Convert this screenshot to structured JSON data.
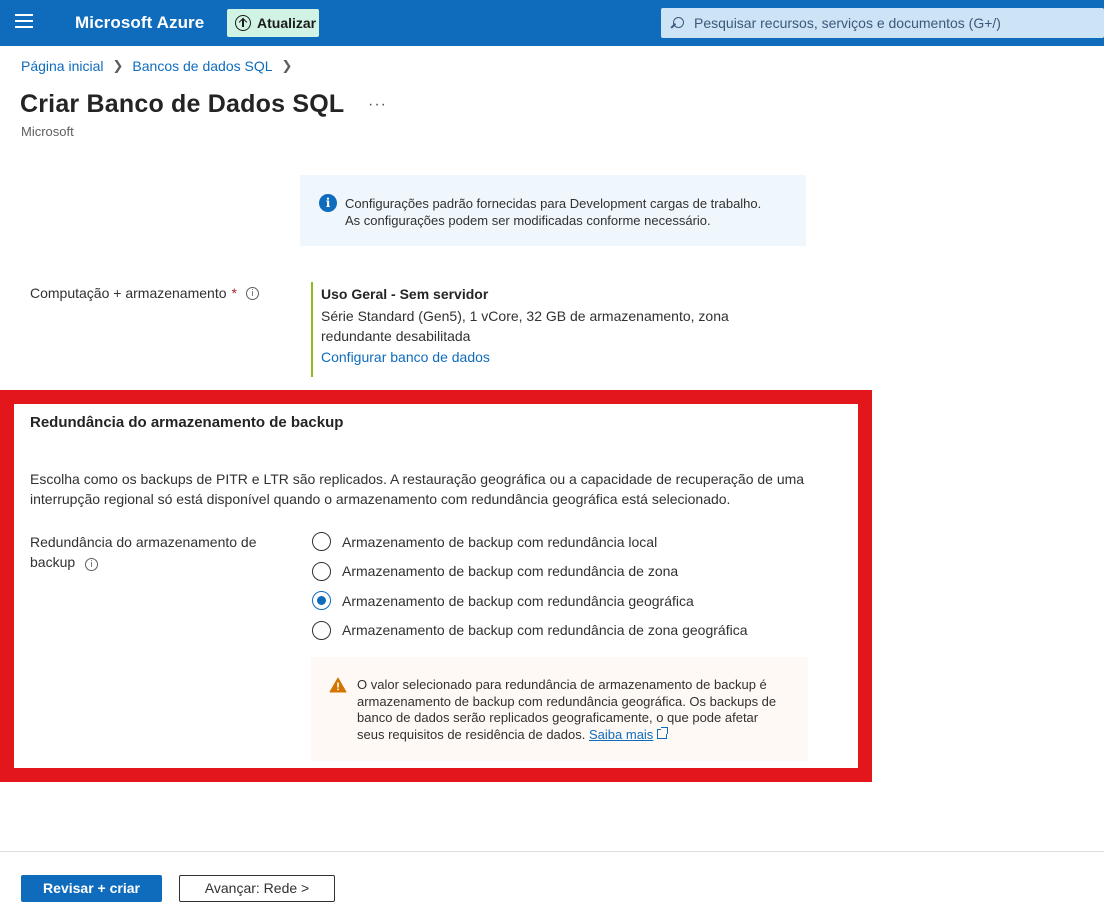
{
  "header": {
    "brand": "Microsoft Azure",
    "update_label": "Atualizar",
    "search_placeholder": "Pesquisar recursos, serviços e documentos (G+/)"
  },
  "breadcrumb": {
    "items": [
      "Página inicial",
      "Bancos de dados SQL"
    ]
  },
  "page": {
    "title": "Criar Banco de Dados SQL",
    "more": "···",
    "subtitle": "Microsoft"
  },
  "info_banner": {
    "line1": "Configurações padrão fornecidas para Development cargas de trabalho.",
    "line2": "As configurações podem ser modificadas conforme necessário."
  },
  "compute": {
    "label": "Computação + armazenamento",
    "required_mark": "*",
    "tier": "Uso Geral - Sem servidor",
    "description": "Série Standard (Gen5), 1 vCore, 32 GB de armazenamento, zona redundante desabilitada",
    "configure_link": "Configurar banco de dados"
  },
  "backup": {
    "section_title": "Redundância do armazenamento de backup",
    "description": "Escolha como os backups de PITR e LTR são replicados. A restauração geográfica ou a capacidade de recuperação de uma interrupção regional só está disponível quando o armazenamento com redundância geográfica está selecionado.",
    "field_label": "Redundância do armazenamento de backup",
    "options": [
      "Armazenamento de backup com redundância local",
      "Armazenamento de backup com redundância de zona",
      "Armazenamento de backup com redundância geográfica",
      "Armazenamento de backup com redundância de zona geográfica"
    ],
    "selected_index": 2,
    "warning_text": "O valor selecionado para redundância de armazenamento de backup é armazenamento de backup com redundância geográfica. Os backups de banco de dados serão replicados geograficamente, o que pode afetar seus requisitos de residência de dados.",
    "learn_more": "Saiba mais"
  },
  "footer": {
    "primary": "Revisar + criar",
    "secondary": "Avançar: Rede >"
  },
  "colors": {
    "header_bg": "#0f6cbd",
    "highlight_border": "#e3161b",
    "compute_accent": "#8cbd18",
    "warning_icon": "#d47500"
  }
}
